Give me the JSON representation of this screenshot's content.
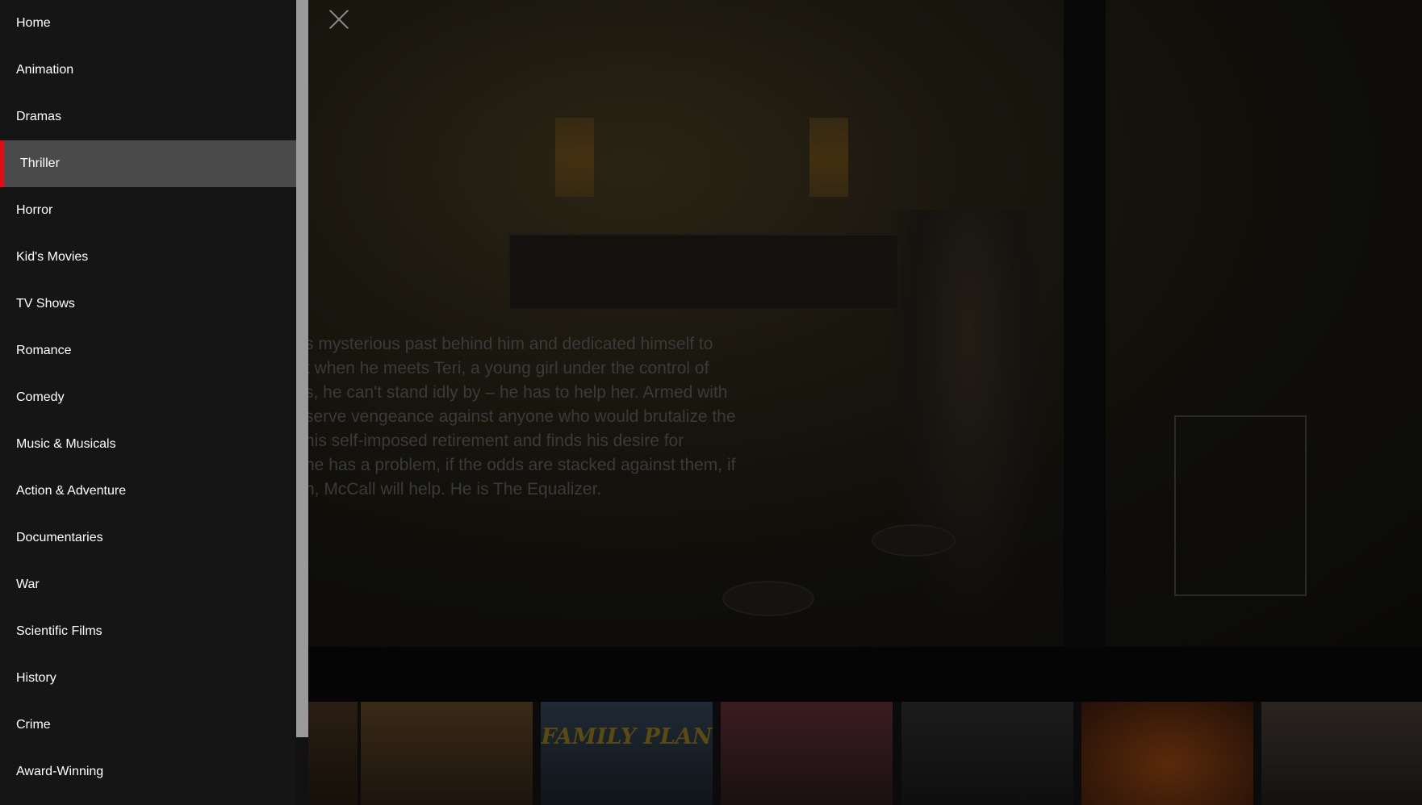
{
  "close_icon": "close-icon",
  "sidebar": {
    "active_color": "#e50914",
    "items": [
      {
        "label": "Home"
      },
      {
        "label": "Animation"
      },
      {
        "label": "Dramas"
      },
      {
        "label": "Thriller",
        "active": true
      },
      {
        "label": "Horror"
      },
      {
        "label": "Kid's Movies"
      },
      {
        "label": "TV Shows"
      },
      {
        "label": "Romance"
      },
      {
        "label": "Comedy"
      },
      {
        "label": "Music & Musicals"
      },
      {
        "label": "Action & Adventure"
      },
      {
        "label": "Documentaries"
      },
      {
        "label": "War"
      },
      {
        "label": "Scientific Films"
      },
      {
        "label": "History"
      },
      {
        "label": "Crime"
      },
      {
        "label": "Award-Winning"
      }
    ]
  },
  "hero": {
    "overview_lines": [
      "s mysterious past behind him and dedicated himself to",
      "t when he meets Teri, a young girl under the control of",
      "s, he can't stand idly by – he has to help her. Armed with",
      "serve vengeance against anyone who would brutalize the",
      "his self-imposed retirement and finds his desire for",
      "he has a problem, if the odds are stacked against them, if",
      "n, McCall will help. He is The Equalizer."
    ]
  },
  "posters": [
    {
      "title": ""
    },
    {
      "title": ""
    },
    {
      "title": "FAMILY PLAN"
    },
    {
      "title": ""
    },
    {
      "title": ""
    },
    {
      "title": ""
    },
    {
      "title": ""
    }
  ]
}
